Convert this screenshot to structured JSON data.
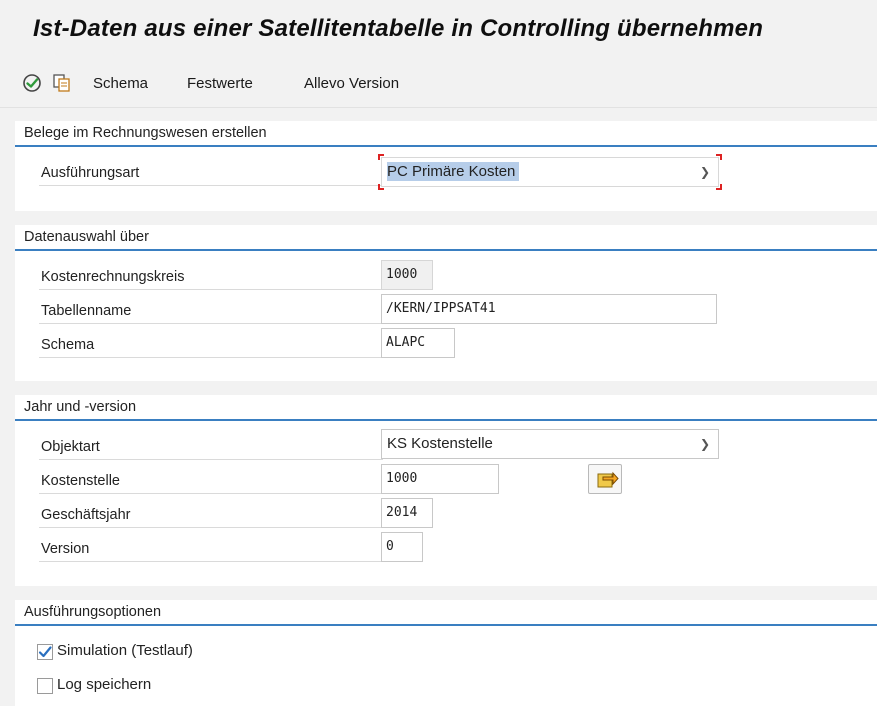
{
  "title": "Ist-Daten aus einer Satellitentabelle in Controlling übernehmen",
  "toolbar": {
    "execute_icon": "execute-icon",
    "copy_icon": "copy-variant-icon",
    "items": [
      "Schema",
      "Festwerte",
      "Allevo Version"
    ]
  },
  "groups": {
    "belege": {
      "title": "Belege im Rechnungswesen erstellen",
      "ausfuehrungsart_label": "Ausführungsart",
      "ausfuehrungsart_value": "PC Primäre Kosten"
    },
    "datenauswahl": {
      "title": "Datenauswahl über",
      "kostenrechnungskreis_label": "Kostenrechnungskreis",
      "kostenrechnungskreis_value": "1000",
      "tabellenname_label": "Tabellenname",
      "tabellenname_value": "/KERN/IPPSAT41",
      "schema_label": "Schema",
      "schema_value": "ALAPC"
    },
    "jahr": {
      "title": "Jahr und -version",
      "objektart_label": "Objektart",
      "objektart_value": "KS Kostenstelle",
      "kostenstelle_label": "Kostenstelle",
      "kostenstelle_value": "1000",
      "geschaeftsjahr_label": "Geschäftsjahr",
      "geschaeftsjahr_value": "2014",
      "version_label": "Version",
      "version_value": "0"
    },
    "optionen": {
      "title": "Ausführungsoptionen",
      "simulation_label": "Simulation (Testlauf)",
      "simulation_checked": true,
      "log_label": "Log speichern",
      "log_checked": false
    }
  },
  "colors": {
    "accent": "#3a7fc1",
    "selection": "#b6cde9",
    "focus_corner": "#dd2222",
    "check": "#2a6fbf"
  }
}
